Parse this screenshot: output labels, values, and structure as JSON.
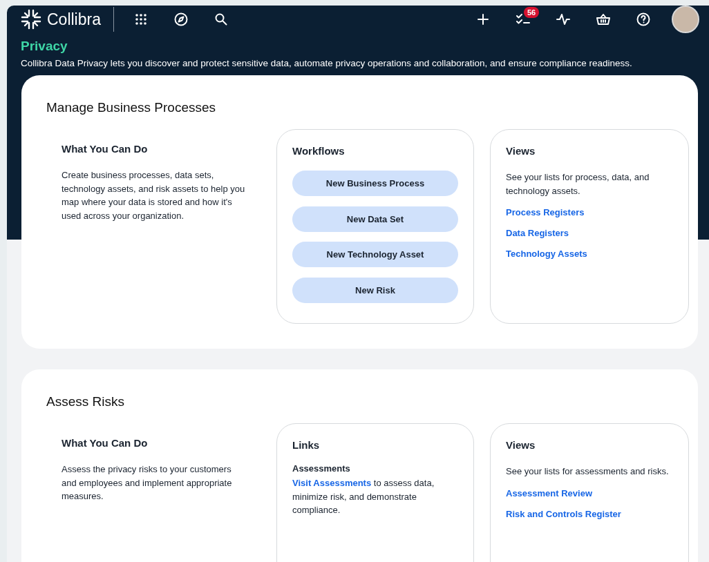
{
  "header": {
    "logo": "Collibra",
    "tasks_badge": "56"
  },
  "hero": {
    "title": "Privacy",
    "description": "Collibra Data Privacy lets you discover and protect sensitive data, automate privacy operations and collaboration, and ensure compliance readiness."
  },
  "sections": [
    {
      "title": "Manage Business Processes",
      "about": {
        "heading": "What You Can Do",
        "text": "Create business processes, data sets, technology assets, and risk assets to help you map where your data is stored and how it's used across your organization."
      },
      "panels": [
        {
          "kind": "workflows",
          "heading": "Workflows",
          "buttons": [
            "New Business Process",
            "New Data Set",
            "New Technology Asset",
            "New Risk"
          ]
        },
        {
          "kind": "views",
          "heading": "Views",
          "text": "See your lists for process, data, and technology assets.",
          "links": [
            "Process Registers",
            "Data Registers",
            "Technology Assets"
          ]
        }
      ]
    },
    {
      "title": "Assess Risks",
      "about": {
        "heading": "What You Can Do",
        "text": "Assess the privacy risks to your customers and employees and implement appropriate measures."
      },
      "panels": [
        {
          "kind": "links",
          "heading": "Links",
          "groups": [
            {
              "title": "Assessments",
              "link": "Visit Assessments",
              "text": " to assess data, minimize risk, and demonstrate compliance."
            }
          ]
        },
        {
          "kind": "views",
          "heading": "Views",
          "text": "See your lists for assessments and risks.",
          "links": [
            "Assessment Review",
            "Risk and Controls Register"
          ]
        }
      ]
    }
  ]
}
